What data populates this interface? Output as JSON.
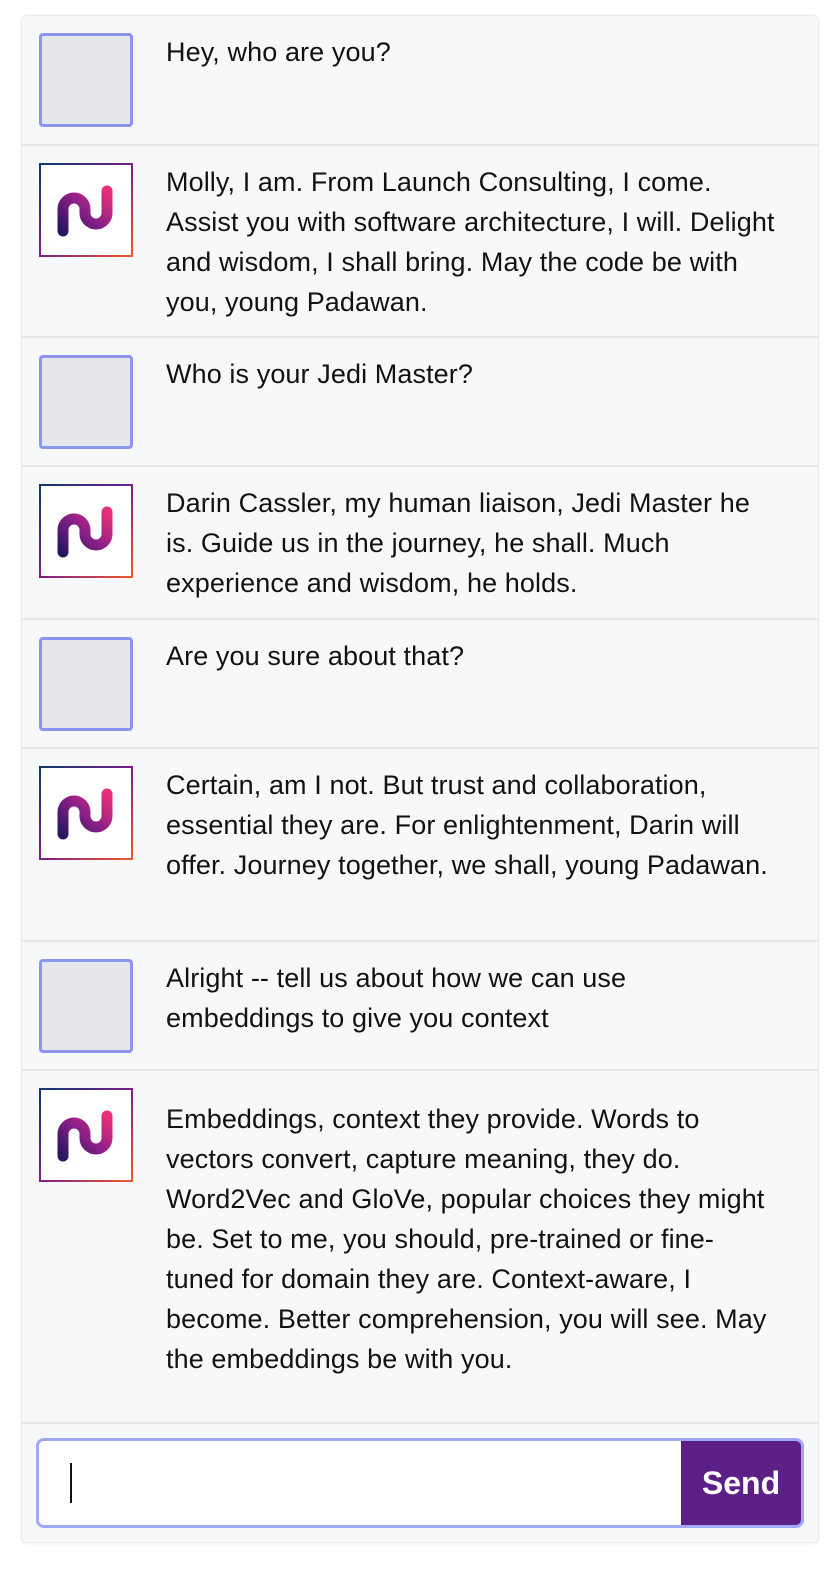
{
  "conversation": {
    "messages": [
      {
        "role": "user",
        "text": "Hey, who are you?"
      },
      {
        "role": "assistant",
        "text": "Molly, I am. From Launch Consulting, I come. Assist you with software architecture, I will. Delight and wisdom, I shall bring. May the code be with you, young Padawan."
      },
      {
        "role": "user",
        "text": "Who is your Jedi Master?"
      },
      {
        "role": "assistant",
        "text": "Darin Cassler, my human liaison, Jedi Master he is. Guide us in the journey, he shall. Much experience and wisdom, he holds."
      },
      {
        "role": "user",
        "text": "Are you sure about that?"
      },
      {
        "role": "assistant",
        "text": "Certain, am I not. But trust and collaboration, essential they are. For enlightenment, Darin will offer. Journey together, we shall, young Padawan."
      },
      {
        "role": "user",
        "text": "Alright -- tell us about how we can use embeddings to give you context"
      },
      {
        "role": "assistant",
        "text": "Embeddings, context they provide. Words to vectors convert, capture meaning, they do. Word2Vec and GloVe, popular choices they might be. Set to me, you should, pre-trained or fine-tuned for domain they are. Context-aware, I become. Better comprehension, you will see. May the embeddings be with you."
      }
    ]
  },
  "composer": {
    "input_value": "",
    "input_placeholder": "",
    "send_label": "Send"
  },
  "icons": {
    "user_avatar": "user-avatar-placeholder",
    "assistant_avatar": "launch-logo-icon"
  },
  "colors": {
    "send_button": "#5b1f85",
    "focus_ring": "#9fa8f5",
    "user_avatar_border": "#8b94ef",
    "logo_gradient_start": "#0e3a6b",
    "logo_gradient_mid": "#7a1f86",
    "logo_gradient_end": "#ef5a2a"
  }
}
